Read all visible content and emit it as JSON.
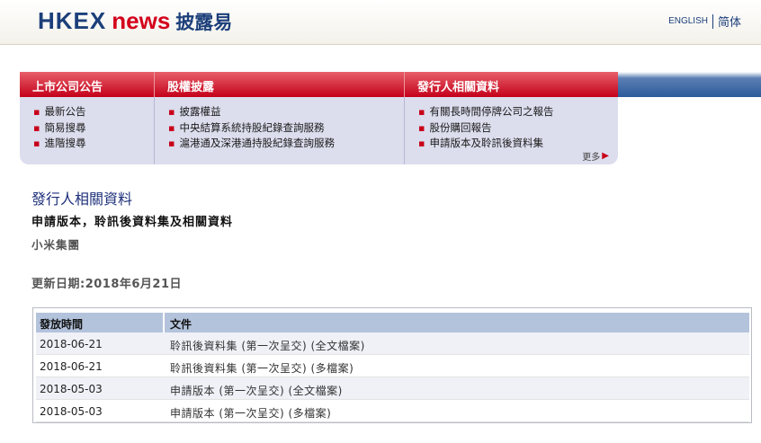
{
  "header": {
    "logo_hkex": "HKEX",
    "logo_news": "news",
    "logo_cn": "披露易",
    "lang_en": "ENGLISH",
    "lang_cn": "简体"
  },
  "nav": {
    "tabs": [
      {
        "label": "上市公司公告",
        "links": [
          "最新公告",
          "簡易搜尋",
          "進階搜尋"
        ]
      },
      {
        "label": "股權披露",
        "links": [
          "披露權益",
          "中央結算系統持股紀錄查詢服務",
          "滬港通及深港通持股紀錄查詢服務"
        ]
      },
      {
        "label": "發行人相關資料",
        "links": [
          "有關長時間停牌公司之報告",
          "股份購回報告",
          "申請版本及聆訊後資料集"
        ]
      }
    ],
    "more": "更多"
  },
  "content": {
    "title1": "發行人相關資料",
    "title2": "申請版本，聆訊後資料集及相關資料",
    "title3": "小米集團",
    "update": "更新日期:2018年6月21日"
  },
  "table": {
    "headers": [
      "發放時間",
      "文件"
    ],
    "rows": [
      {
        "date": "2018-06-21",
        "doc": "聆訊後資料集 (第一次呈交) (全文檔案)"
      },
      {
        "date": "2018-06-21",
        "doc": "聆訊後資料集 (第一次呈交) (多檔案)"
      },
      {
        "date": "2018-05-03",
        "doc": "申請版本 (第一次呈交) (全文檔案)"
      },
      {
        "date": "2018-05-03",
        "doc": "申請版本 (第一次呈交) (多檔案)"
      }
    ]
  },
  "colors": {
    "brand_blue": "#1c3f7a",
    "brand_red": "#d4001b",
    "nav_panel": "#dcdded",
    "table_header": "#b4c3dc"
  }
}
